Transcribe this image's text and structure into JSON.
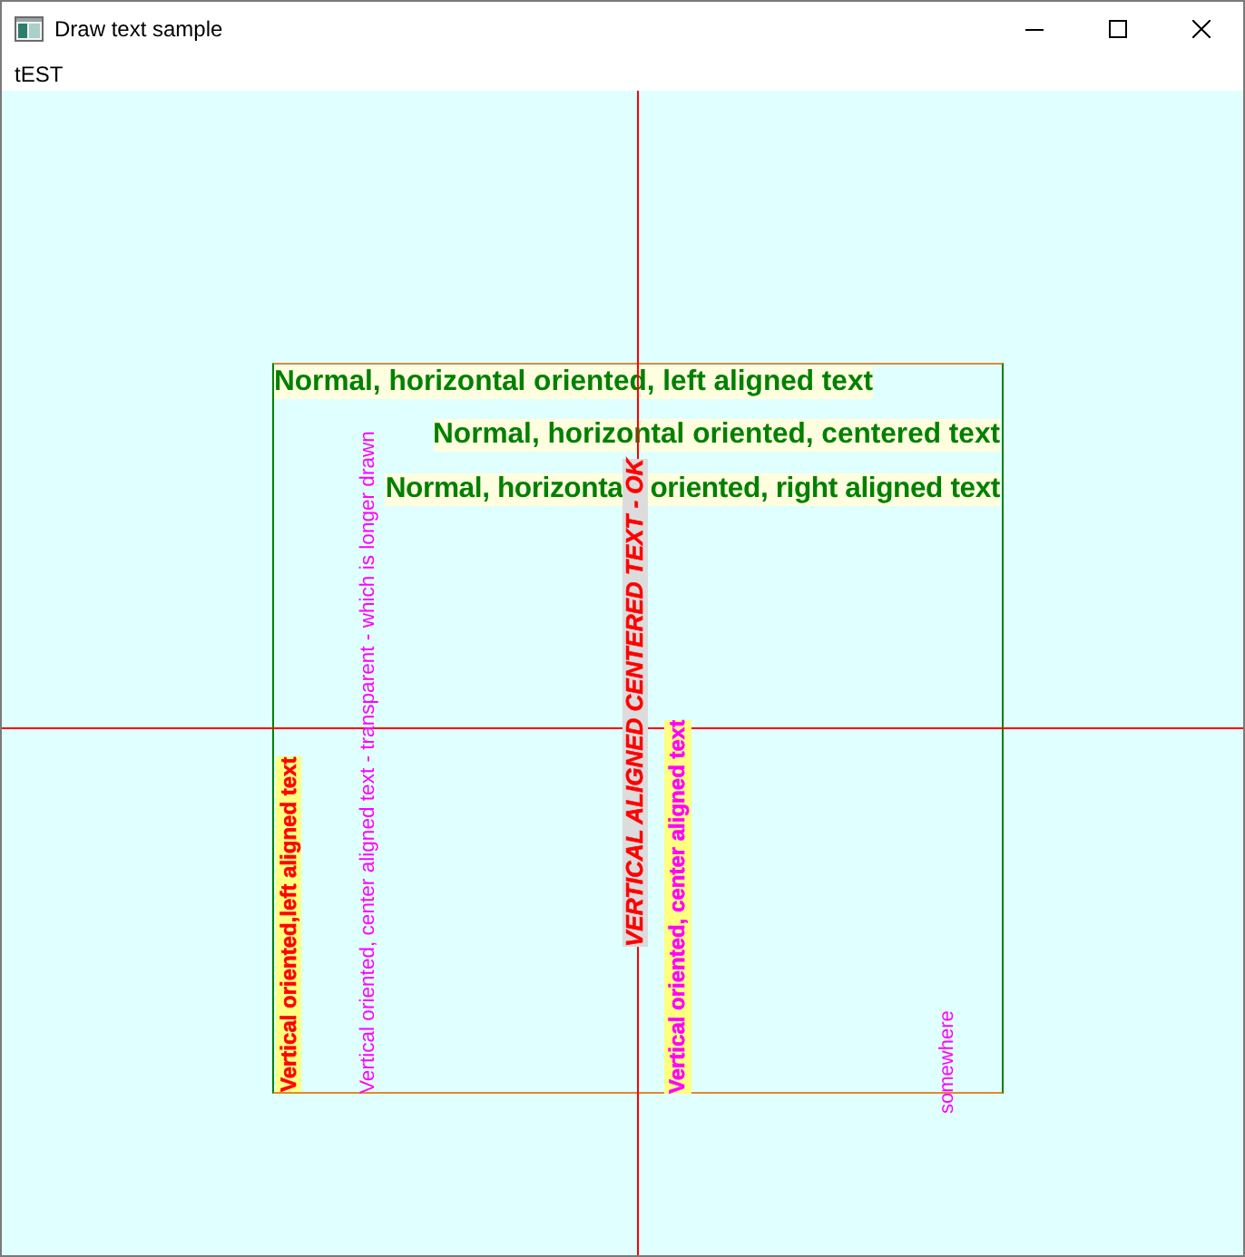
{
  "window": {
    "title": "Draw text sample"
  },
  "menu": [
    {
      "label": "tEST"
    }
  ],
  "canvas": {
    "texts": [
      {
        "kind": "horizontal",
        "text": "Normal, horizontal oriented, left aligned text",
        "bold": true,
        "italic": false
      },
      {
        "kind": "horizontal",
        "text": "Normal, horizontal oriented, centered text",
        "bold": true,
        "italic": false
      },
      {
        "kind": "horizontal",
        "segments": [
          "Normal, horizonta",
          "oriented, right aligned text"
        ],
        "bold": true,
        "italic": false
      },
      {
        "kind": "vertical",
        "text": "Vertical oriented,left aligned text",
        "bold": true,
        "italic": false
      },
      {
        "kind": "vertical",
        "text": "Vertical oriented, center aligned text - transparent - which is longer drawn",
        "bold": false,
        "italic": false
      },
      {
        "kind": "vertical",
        "text": "VERTICAL ALIGNED CENTERED TEXT - OK",
        "bold": true,
        "italic": true
      },
      {
        "kind": "vertical",
        "text": "Vertical oriented, center aligned text",
        "bold": true,
        "italic": false
      },
      {
        "kind": "vertical",
        "text": "somewhere",
        "bold": false,
        "italic": false
      }
    ]
  }
}
